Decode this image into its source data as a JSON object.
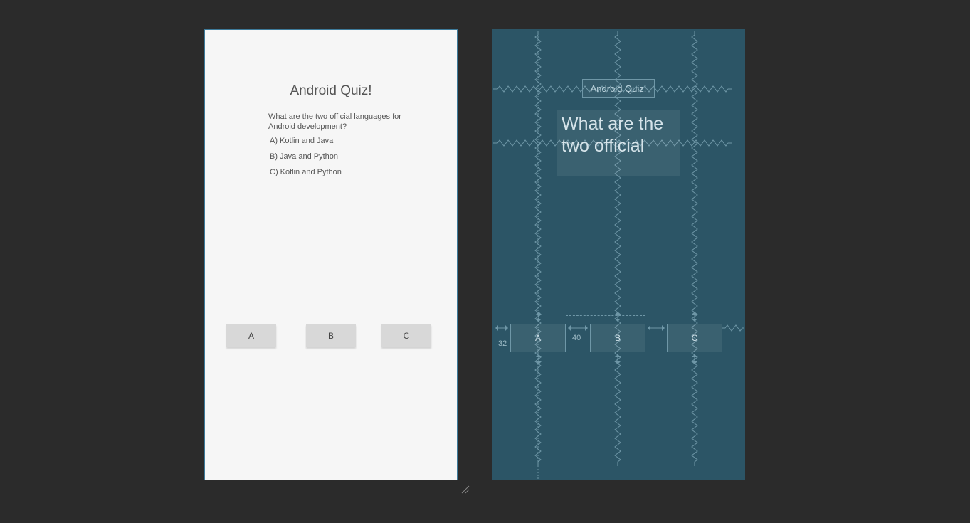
{
  "preview": {
    "title": "Android Quiz!",
    "question": "What are the two official languages for Android development?",
    "options": {
      "a": "A) Kotlin and Java",
      "b": "B) Java and Python",
      "c": "C) Kotlin and Python"
    },
    "buttons": {
      "a": "A",
      "b": "B",
      "c": "C"
    }
  },
  "blueprint": {
    "title": "Android Quiz!",
    "question_preview": "What are the two official",
    "buttons": {
      "a": "A",
      "b": "B",
      "c": "C"
    },
    "margins": {
      "left": "32",
      "button_gap": "40"
    }
  }
}
